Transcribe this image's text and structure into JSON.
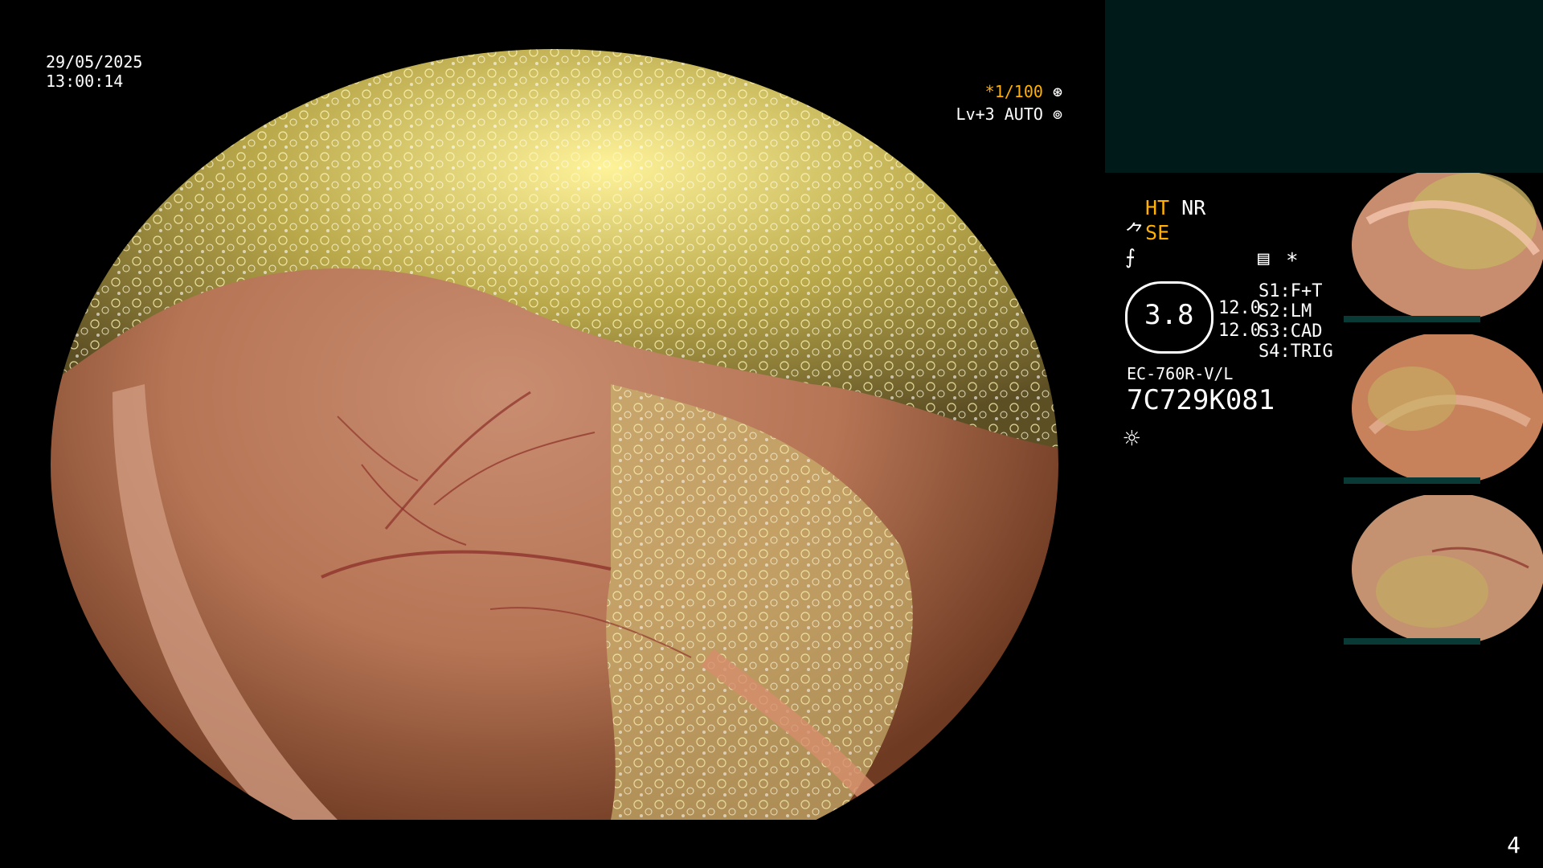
{
  "overlay": {
    "date": "29/05/2025",
    "time": "13:00:14",
    "exposure": "*1/100",
    "level": "Lv+3 AUTO"
  },
  "settings": {
    "ht": "HT",
    "nr": "NR",
    "se": "SE",
    "dial_value": "3.8",
    "value_1": "12.0",
    "value_2": "12.0",
    "s1": {
      "key": "S1:",
      "value": "F+T"
    },
    "s2": {
      "key": "S2:",
      "value": "LM"
    },
    "s3": {
      "key": "S3:",
      "value": "CAD"
    },
    "s4": {
      "key": "S4:",
      "value": "TRIG"
    },
    "asterisk": "*"
  },
  "scope": {
    "model": "EC-760R-V/L",
    "serial": "7C729K081"
  },
  "page_number": "4",
  "colors": {
    "orange": "#ffb000",
    "panel": "#001a1a",
    "thumb_bar": "#0a3a35"
  },
  "icons": [
    "shutter-icon",
    "auto-iris-icon",
    "fiber-icon",
    "curve-icon",
    "menu-icon",
    "light-icon"
  ]
}
